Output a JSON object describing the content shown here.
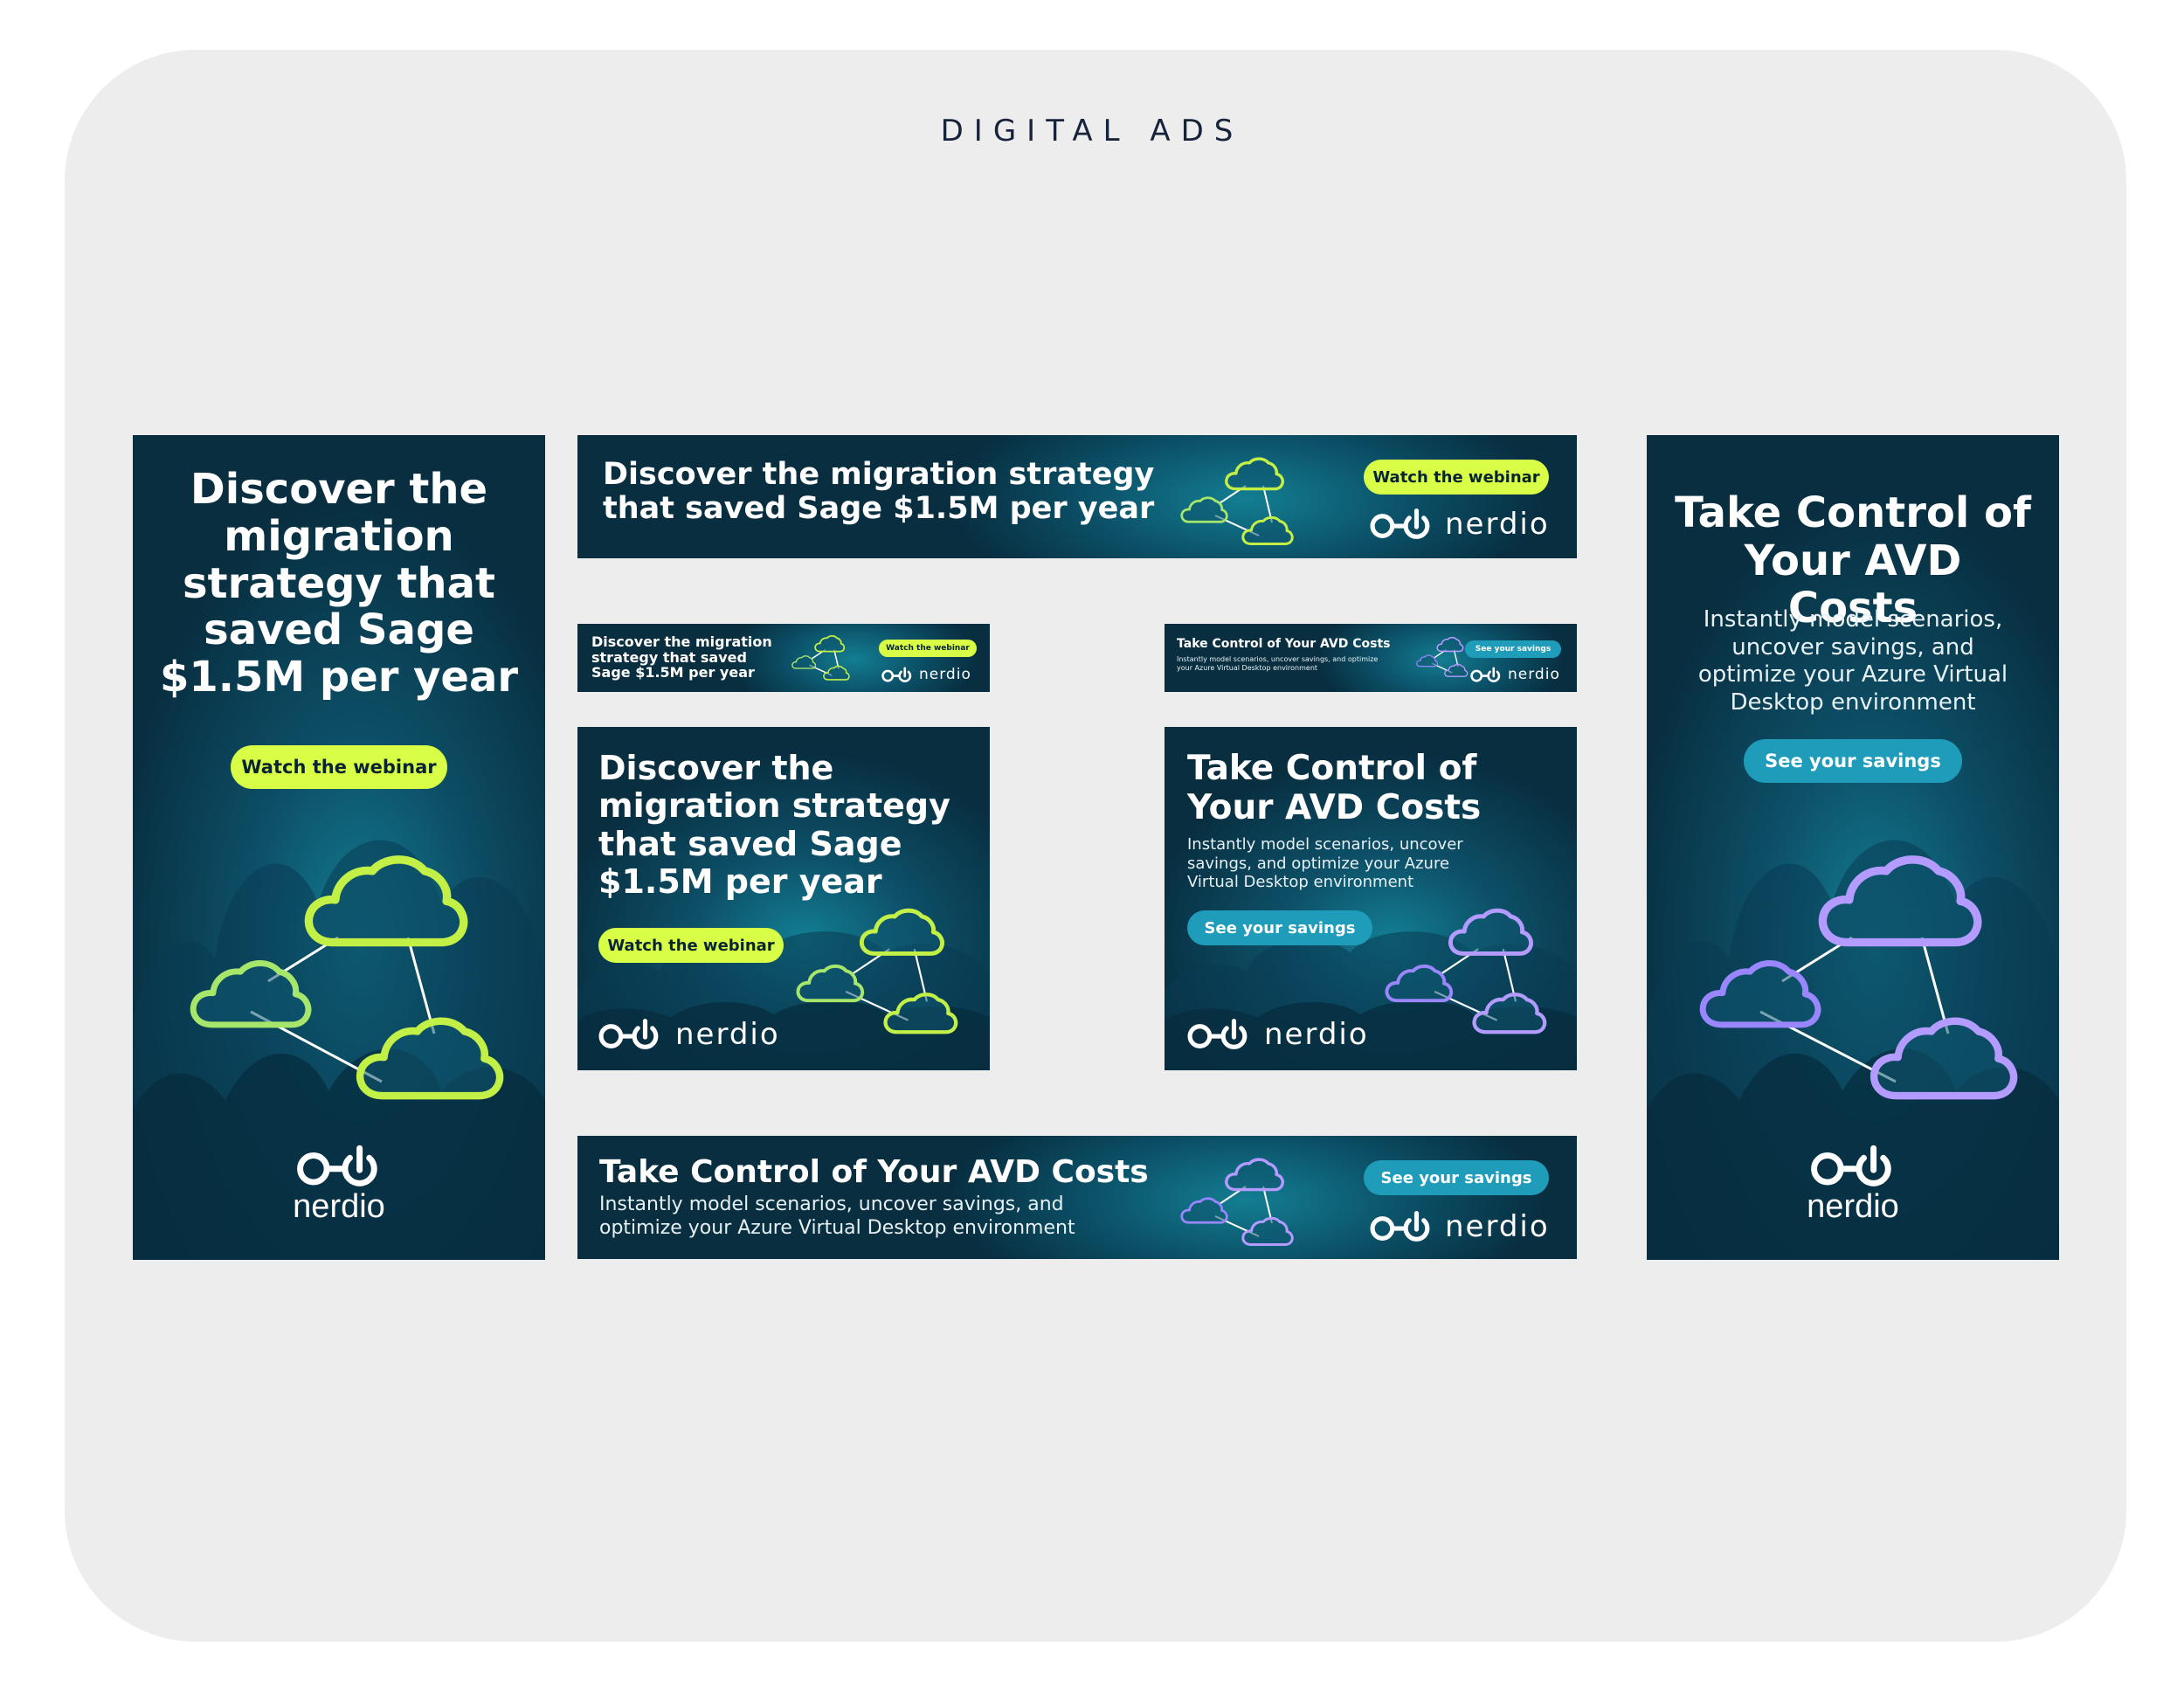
{
  "page": {
    "title": "DIGITAL ADS"
  },
  "brand": {
    "name": "nerdio",
    "logo_icon": "nerdio-logo-icon"
  },
  "colors": {
    "background_panel": "#ededee",
    "ad_dark": "#082e40",
    "ad_teal": "#127e93",
    "accent_lime": "#d8ff45",
    "accent_blue": "#1f9cba",
    "cloud_green": "#b7ef3a",
    "cloud_purple": "#a48bff"
  },
  "campaign_webinar": {
    "headline": "Discover the migration strategy that saved Sage $1.5M per year",
    "cta": "Watch the webinar"
  },
  "campaign_savings": {
    "headline": "Take Control of Your AVD Costs",
    "body": "Instantly model scenarios, uncover savings, and optimize your Azure Virtual Desktop environment",
    "cta": "See your savings"
  }
}
